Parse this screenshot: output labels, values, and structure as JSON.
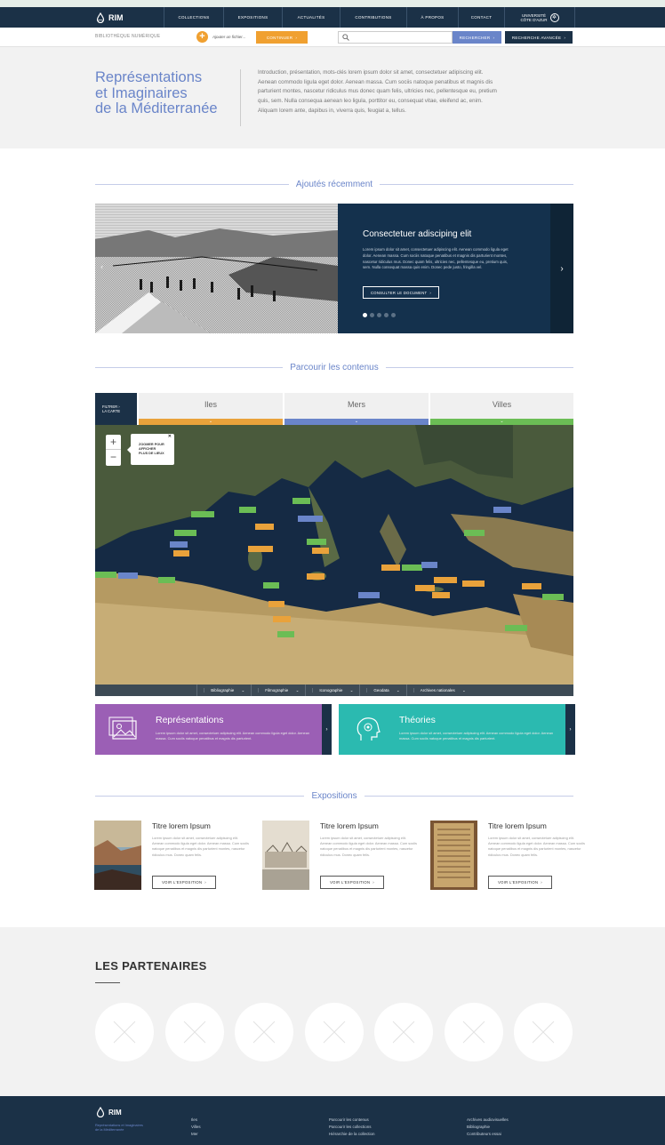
{
  "nav": {
    "logo": "RIM",
    "items": [
      "COLLECTIONS",
      "EXPOSITIONS",
      "ACTUALITÉS",
      "CONTRIBUTIONS",
      "À PROPOS",
      "CONTACT"
    ],
    "university_line1": "UNIVERSITÉ",
    "university_line2": "CÔTE D'AZUR"
  },
  "toolbar": {
    "site_label": "BIBLIOTHÈQUE NUMÉRIQUE",
    "add_file": "Ajouter un fichier...",
    "continue": "CONTINUER",
    "search_placeholder": "",
    "search_button": "RECHERCHER",
    "advanced_button": "RECHERCHE AVANCÉE"
  },
  "hero": {
    "title_line1": "Représentations",
    "title_line2": "et Imaginaires",
    "title_line3": "de la Méditerranée",
    "intro": "Introduction, présentation, mots-clés lorem ipsum dolor sit amet, consectetuer adipiscing elit. Aenean commodo ligula eget dolor. Aenean massa. Cum sociis natoque penatibus et magnis dis parturient montes, nascetur ridiculus mus donec quam felis, ultricies nec, pellentesque eu, pretium quis, sem. Nulla consequa aenean leo ligula, porttitor eu, consequat vitae, eleifend ac, enim. Aliquam lorem ante, dapibus in, viverra quis, feugiat a, tellus."
  },
  "recent": {
    "section_title": "Ajoutés récemment",
    "slide_title": "Consectetuer adisciping elit",
    "slide_text": "Lorem ipsum dolor sit amet, consectetuer adipiscing elit. Aenean commodo ligula eget dolor. Aenean massa. Cum sociis natoque penatibus et magnis dis parturient montes, nascetur ridiculus mus. Donec quam felis, ultricies nec, pellentesque eu, pretium quis, sem. Nulla consequat massa quis enim. Donec pede justo, fringilla vel.",
    "doc_button": "CONSULTER LE DOCUMENT",
    "slide_count": 5,
    "active_slide": 1
  },
  "browse": {
    "section_title": "Parcourir les contenus",
    "filter_line1": "FILTRER",
    "filter_line2": "LA CARTE",
    "tabs": [
      {
        "label": "Iles",
        "color": "#e9a23b"
      },
      {
        "label": "Mers",
        "color": "#6a85c9"
      },
      {
        "label": "Villes",
        "color": "#6bbd55"
      }
    ],
    "tooltip_line1": "ZOOMER POUR",
    "tooltip_line2": "AFFICHER",
    "tooltip_line3": "PLUS DE LIEUX",
    "map_filters": [
      "Bibliographie",
      "Filmographie",
      "Iconographie",
      "Geodata",
      "Archives nationales"
    ]
  },
  "cards": {
    "rep_title": "Représentations",
    "rep_text": "Lorem ipsum dolor sit amet, consectetuer adipiscing elit. Aenean commodo ligula eget dolor. Aenean massa. Cum sociis natoque penatibus et magnis dis parturient.",
    "theo_title": "Théories",
    "theo_text": "Lorem ipsum dolor sit amet, consectetuer adipiscing elit. Aenean commodo ligula eget dolor. Aenean massa. Cum sociis natoque penatibus et magnis dis parturient.",
    "rep_color": "#9b5fb5",
    "theo_color": "#2bbab0"
  },
  "expositions": {
    "section_title": "Expositions",
    "items": [
      {
        "title": "Titre lorem Ipsum",
        "text": "Lorem ipsum dolor sit amet, consectetuer adipiscing elit. Aenean commodo ligula eget dolor. Aenean massa. Cum sociis natoque penatibus et magnis dis parturient montes, nascetur ridiculus mus. Donec quam felis.",
        "button": "VOIR L'EXPOSITION"
      },
      {
        "title": "Titre lorem Ipsum",
        "text": "Lorem ipsum dolor sit amet, consectetuer adipiscing elit. Aenean commodo ligula eget dolor. Aenean massa. Cum sociis natoque penatibus et magnis dis parturient montes, nascetur ridiculus mus. Donec quam felis.",
        "button": "VOIR L'EXPOSITION"
      },
      {
        "title": "Titre lorem Ipsum",
        "text": "Lorem ipsum dolor sit amet, consectetuer adipiscing elit. Aenean commodo ligula eget dolor. Aenean massa. Cum sociis natoque penatibus et magnis dis parturient montes, nascetur ridiculus mus. Donec quam felis.",
        "button": "VOIR L'EXPOSITION"
      }
    ]
  },
  "partners": {
    "title": "LES PARTENAIRES",
    "count": 7
  },
  "footer": {
    "logo": "RIM",
    "subtitle_line1": "Représentations et Imaginaires",
    "subtitle_line2": "de la Méditerranée",
    "col1": [
      "Iles",
      "Villes",
      "Mer"
    ],
    "col2": [
      "Parcourir les contenus",
      "Parcourir les collections",
      "Hiérarchie de la collection"
    ],
    "col3": [
      "Archives audiovisuelles",
      "Bibliographie",
      "Contributeurs essai"
    ]
  }
}
